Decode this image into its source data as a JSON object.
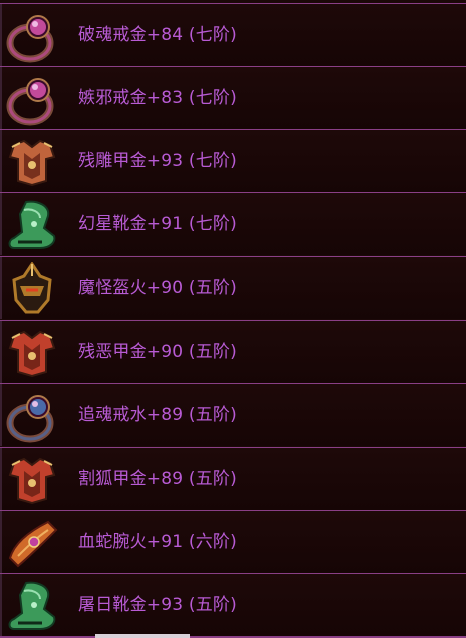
{
  "items": [
    {
      "label": "破魂戒金+84 (七阶)",
      "icon": "ring-icon",
      "color": "#c24a9a"
    },
    {
      "label": "嫉邪戒金+83 (七阶)",
      "icon": "ring-icon",
      "color": "#c24a9a"
    },
    {
      "label": "残雕甲金+93 (七阶)",
      "icon": "armor-icon",
      "color": "#c0643c"
    },
    {
      "label": "幻星靴金+91 (七阶)",
      "icon": "boots-icon",
      "color": "#3c9a5a"
    },
    {
      "label": "魔怪盔火+90 (五阶)",
      "icon": "helmet-icon",
      "color": "#b07a2a"
    },
    {
      "label": "残恶甲金+90 (五阶)",
      "icon": "armor-icon",
      "color": "#c0402c"
    },
    {
      "label": "追魂戒水+89 (五阶)",
      "icon": "ring-icon",
      "color": "#4a6aa8"
    },
    {
      "label": "割狐甲金+89 (五阶)",
      "icon": "armor-icon",
      "color": "#c0402c"
    },
    {
      "label": "血蛇腕火+91 (六阶)",
      "icon": "bracer-icon",
      "color": "#d06a2a"
    },
    {
      "label": "屠日靴金+93 (五阶)",
      "icon": "boots-icon",
      "color": "#3c9a5a"
    }
  ]
}
